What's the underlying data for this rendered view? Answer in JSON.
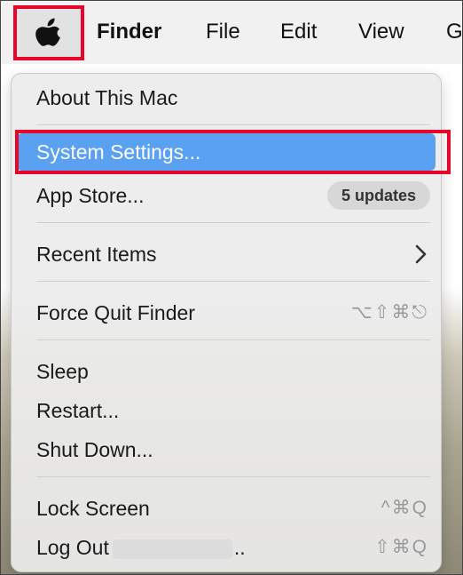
{
  "menubar": {
    "app_name": "Finder",
    "items": [
      "File",
      "Edit",
      "View",
      "G"
    ]
  },
  "apple_menu": {
    "about": "About This Mac",
    "system_settings": "System Settings...",
    "app_store": "App Store...",
    "app_store_badge": "5 updates",
    "recent_items": "Recent Items",
    "force_quit": "Force Quit Finder",
    "force_quit_shortcut": "⌥⇧⌘⎋",
    "sleep": "Sleep",
    "restart": "Restart...",
    "shut_down": "Shut Down...",
    "lock_screen": "Lock Screen",
    "lock_screen_shortcut": "^⌘Q",
    "log_out_prefix": "Log Out",
    "log_out_suffix": "..",
    "log_out_shortcut": "⇧⌘Q"
  },
  "colors": {
    "highlight": "#5aa1f2",
    "annotation_red": "#e6062a"
  }
}
